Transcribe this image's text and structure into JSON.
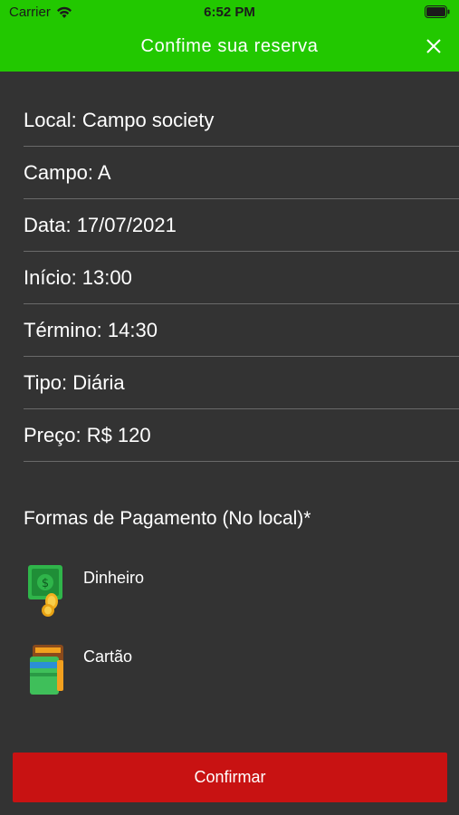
{
  "status_bar": {
    "carrier": "Carrier",
    "time": "6:52 PM"
  },
  "header": {
    "title": "Confime sua reserva",
    "close_icon": "close-icon"
  },
  "details": [
    {
      "text": "Local: Campo society"
    },
    {
      "text": "Campo: A"
    },
    {
      "text": "Data: 17/07/2021"
    },
    {
      "text": "Início: 13:00"
    },
    {
      "text": "Término: 14:30"
    },
    {
      "text": "Tipo: Diária"
    },
    {
      "text": "Preço: R$ 120"
    }
  ],
  "payment": {
    "title": "Formas de Pagamento (No local)*",
    "methods": [
      {
        "label": "Dinheiro",
        "icon": "cash-icon"
      },
      {
        "label": "Cartão",
        "icon": "wallet-card-icon"
      }
    ]
  },
  "confirm_button": {
    "label": "Confirmar"
  },
  "colors": {
    "header_bg": "#22c800",
    "body_bg": "#333333",
    "confirm_bg": "#c81212"
  }
}
